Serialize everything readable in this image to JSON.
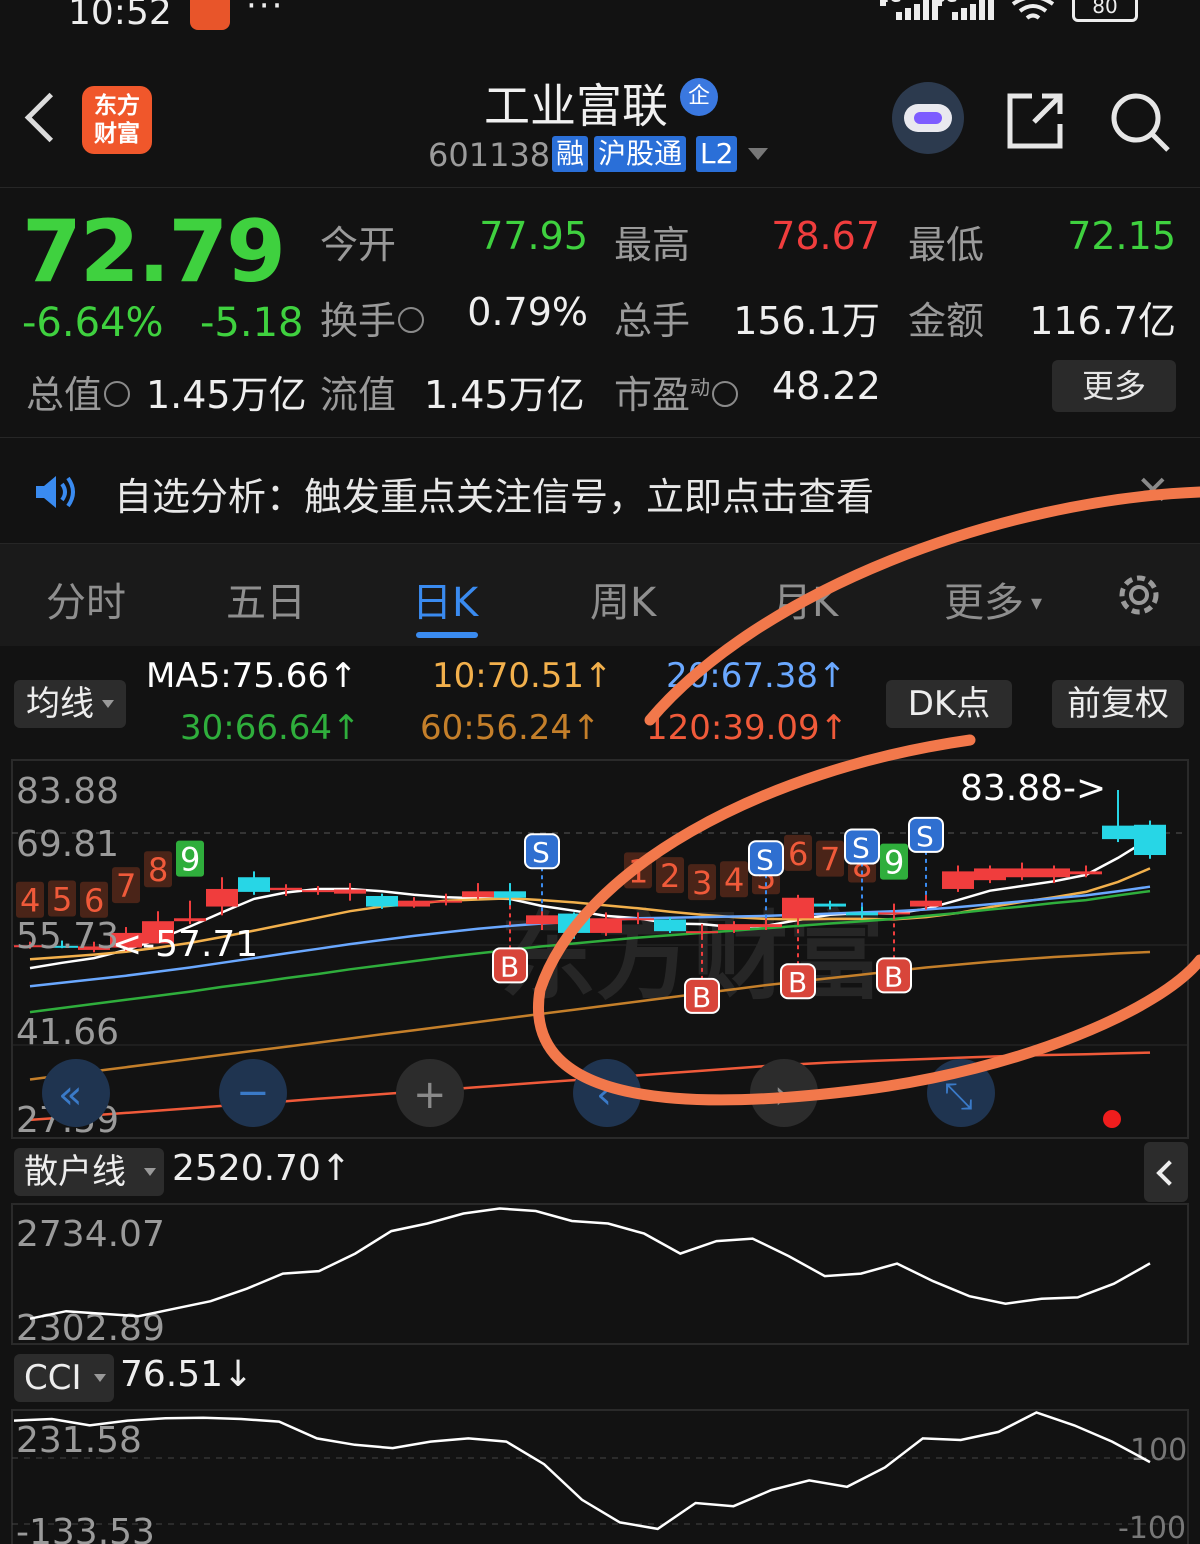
{
  "status": {
    "time": "10:52",
    "more": "···",
    "signal1": "4G",
    "signal2": "5G",
    "battery": "80"
  },
  "header": {
    "logo_line1": "东方",
    "logo_line2": "财富",
    "title": "工业富联",
    "ent_badge": "企",
    "code": "601138",
    "tags": [
      "融",
      "沪股通",
      "L2"
    ]
  },
  "quote": {
    "price": "72.79",
    "pct": "-6.64%",
    "chg": "-5.18",
    "rows": [
      [
        {
          "l": "今开",
          "v": "77.95",
          "c": "green"
        },
        {
          "l": "最高",
          "v": "78.67",
          "c": "red"
        },
        {
          "l": "最低",
          "v": "72.15",
          "c": "green"
        }
      ],
      [
        {
          "l": "换手",
          "v": "0.79%",
          "c": ""
        },
        {
          "l": "总手",
          "v": "156.1万",
          "c": ""
        },
        {
          "l": "金额",
          "v": "116.7亿",
          "c": ""
        }
      ]
    ],
    "total_value_label": "总值",
    "total_value": "1.45万亿",
    "float_label": "流值",
    "float_value": "1.45万亿",
    "pe_label": "市盈",
    "pe_sup": "动",
    "pe_value": "48.22",
    "more": "更多"
  },
  "notice": {
    "text": "自选分析：触发重点关注信号，立即点击查看",
    "close": "✕"
  },
  "tabs": {
    "items": [
      "分时",
      "五日",
      "日K",
      "周K",
      "月K",
      "更多"
    ],
    "active": "日K"
  },
  "chart_header": {
    "ma_button": "均线",
    "ma5": "MA5:75.66↑",
    "ma10": "10:70.51↑",
    "ma20": "20:67.38↑",
    "ma30": "30:66.64↑",
    "ma60": "60:56.24↑",
    "ma120": "120:39.09↑",
    "dk_button": "DK点",
    "adjust_button": "前复权"
  },
  "colors": {
    "up": "#f03d3d",
    "down": "#27d6e6",
    "ma5": "#ffffff",
    "ma10": "#f2b04c",
    "ma20": "#6aa8ff",
    "ma30": "#2fae3c",
    "ma60": "#c47f2a",
    "ma120": "#f05a3a",
    "annotation": "#f2784b"
  },
  "chart_data": [
    {
      "type": "candlestick",
      "y_ticks": [
        "83.88",
        "69.81",
        "55.73",
        "41.66",
        "27.59"
      ],
      "ylim": [
        27.59,
        83.88
      ],
      "high_label": "83.88->",
      "low_label": "<-57.71",
      "watermark": "东方财富",
      "candles": [
        {
          "o": 57.2,
          "c": 57.4,
          "h": 58.0,
          "l": 56.8
        },
        {
          "o": 57.3,
          "c": 57.1,
          "h": 58.2,
          "l": 56.9
        },
        {
          "o": 56.6,
          "c": 57.2,
          "h": 58.0,
          "l": 56.2
        },
        {
          "o": 57.0,
          "c": 59.5,
          "h": 60.5,
          "l": 56.4
        },
        {
          "o": 57.7,
          "c": 61.5,
          "h": 63.2,
          "l": 57.7
        },
        {
          "o": 61.5,
          "c": 62.0,
          "h": 65.0,
          "l": 61.0
        },
        {
          "o": 64.0,
          "c": 67.0,
          "h": 69.0,
          "l": 62.5
        },
        {
          "o": 69.0,
          "c": 66.5,
          "h": 70.0,
          "l": 66.0
        },
        {
          "o": 66.8,
          "c": 67.2,
          "h": 67.8,
          "l": 65.8
        },
        {
          "o": 66.5,
          "c": 66.8,
          "h": 67.5,
          "l": 66.0
        },
        {
          "o": 66.2,
          "c": 66.9,
          "h": 68.0,
          "l": 65.0
        },
        {
          "o": 65.8,
          "c": 64.0,
          "h": 66.2,
          "l": 63.6
        },
        {
          "o": 64.0,
          "c": 65.0,
          "h": 65.6,
          "l": 63.8
        },
        {
          "o": 65.0,
          "c": 65.0,
          "h": 66.2,
          "l": 64.2
        },
        {
          "o": 65.6,
          "c": 66.6,
          "h": 68.0,
          "l": 65.2
        },
        {
          "o": 66.6,
          "c": 65.5,
          "h": 68.0,
          "l": 64.2
        },
        {
          "o": 61.0,
          "c": 62.5,
          "h": 63.2,
          "l": 60.0
        },
        {
          "o": 62.8,
          "c": 59.5,
          "h": 63.0,
          "l": 58.5
        },
        {
          "o": 59.5,
          "c": 62.0,
          "h": 63.0,
          "l": 59.0
        },
        {
          "o": 62.0,
          "c": 62.0,
          "h": 63.0,
          "l": 61.0
        },
        {
          "o": 61.8,
          "c": 59.8,
          "h": 62.2,
          "l": 59.5
        },
        {
          "o": 59.8,
          "c": 59.8,
          "h": 61.0,
          "l": 59.0
        },
        {
          "o": 60.0,
          "c": 61.0,
          "h": 61.5,
          "l": 59.5
        },
        {
          "o": 60.5,
          "c": 61.0,
          "h": 62.0,
          "l": 60.0
        },
        {
          "o": 62.0,
          "c": 65.5,
          "h": 66.0,
          "l": 61.5
        },
        {
          "o": 64.5,
          "c": 64.0,
          "h": 65.0,
          "l": 63.5
        },
        {
          "o": 63.0,
          "c": 62.5,
          "h": 64.0,
          "l": 62.0
        },
        {
          "o": 63.0,
          "c": 63.0,
          "h": 64.5,
          "l": 62.5
        },
        {
          "o": 64.0,
          "c": 65.0,
          "h": 66.0,
          "l": 63.5
        },
        {
          "o": 67.0,
          "c": 70.0,
          "h": 71.0,
          "l": 66.5
        },
        {
          "o": 68.5,
          "c": 70.5,
          "h": 71.0,
          "l": 68.0
        },
        {
          "o": 69.0,
          "c": 70.5,
          "h": 71.5,
          "l": 68.5
        },
        {
          "o": 69.0,
          "c": 70.5,
          "h": 71.0,
          "l": 68.0
        },
        {
          "o": 69.5,
          "c": 70.0,
          "h": 71.0,
          "l": 69.0
        },
        {
          "o": 77.8,
          "c": 75.5,
          "h": 83.88,
          "l": 75.0
        },
        {
          "o": 77.95,
          "c": 72.79,
          "h": 78.67,
          "l": 72.15
        }
      ],
      "ma_lines": [
        {
          "name": "MA5",
          "color": "#ffffff",
          "values": [
            53.5,
            54.4,
            55.2,
            56.6,
            58.4,
            60.6,
            63.0,
            65.3,
            66.4,
            67.0,
            67.0,
            66.6,
            66.0,
            65.6,
            65.4,
            65.3,
            64.1,
            63.3,
            62.4,
            62.0,
            61.1,
            61.0,
            60.5,
            60.7,
            61.7,
            62.6,
            62.9,
            62.8,
            63.6,
            65.1,
            66.7,
            67.5,
            68.3,
            69.4,
            72.3,
            75.66
          ]
        },
        {
          "name": "10",
          "color": "#f2b04c",
          "values": [
            55.0,
            55.4,
            55.8,
            56.3,
            57.0,
            57.8,
            58.8,
            59.9,
            61.0,
            62.1,
            63.2,
            64.0,
            64.5,
            65.0,
            65.2,
            65.4,
            65.1,
            64.7,
            64.2,
            63.7,
            63.1,
            62.6,
            62.2,
            61.9,
            61.8,
            61.9,
            61.9,
            61.8,
            62.2,
            62.9,
            63.9,
            64.8,
            65.6,
            66.5,
            68.2,
            70.51
          ]
        },
        {
          "name": "20",
          "color": "#6aa8ff",
          "values": [
            50.4,
            51.0,
            51.6,
            52.2,
            52.9,
            53.6,
            54.4,
            55.2,
            56.0,
            56.8,
            57.6,
            58.3,
            59.0,
            59.6,
            60.2,
            60.7,
            61.1,
            61.4,
            61.7,
            62.0,
            62.1,
            62.2,
            62.3,
            62.4,
            62.6,
            62.8,
            63.0,
            63.2,
            63.5,
            63.9,
            64.4,
            64.9,
            65.4,
            65.9,
            66.6,
            67.38
          ]
        },
        {
          "name": "30",
          "color": "#2fae3c",
          "values": [
            46.0,
            46.7,
            47.4,
            48.1,
            48.8,
            49.5,
            50.3,
            51.0,
            51.8,
            52.5,
            53.3,
            54.0,
            54.7,
            55.4,
            56.0,
            56.6,
            57.2,
            57.7,
            58.2,
            58.7,
            59.1,
            59.5,
            59.9,
            60.3,
            60.7,
            61.1,
            61.5,
            61.9,
            62.4,
            62.9,
            63.5,
            64.0,
            64.6,
            65.1,
            65.9,
            66.64
          ]
        },
        {
          "name": "60",
          "color": "#c47f2a",
          "values": [
            34.5,
            35.2,
            35.9,
            36.6,
            37.3,
            38.0,
            38.7,
            39.4,
            40.1,
            40.8,
            41.5,
            42.2,
            42.9,
            43.6,
            44.3,
            45.0,
            45.7,
            46.4,
            47.1,
            47.8,
            48.5,
            49.2,
            49.9,
            50.6,
            51.2,
            51.8,
            52.4,
            53.0,
            53.6,
            54.1,
            54.6,
            55.0,
            55.4,
            55.7,
            56.0,
            56.24
          ]
        },
        {
          "name": "120",
          "color": "#f05a3a",
          "values": [
            27.6,
            28.0,
            28.4,
            28.8,
            29.2,
            29.6,
            30.0,
            30.4,
            30.8,
            31.2,
            31.6,
            32.0,
            32.4,
            32.8,
            33.2,
            33.6,
            34.0,
            34.4,
            34.8,
            35.2,
            35.6,
            36.0,
            36.4,
            36.8,
            37.1,
            37.4,
            37.6,
            37.8,
            38.0,
            38.2,
            38.4,
            38.6,
            38.7,
            38.8,
            38.95,
            39.09
          ]
        }
      ],
      "td_labels": [
        {
          "i": 0,
          "t": "4",
          "c": "#f05a3a"
        },
        {
          "i": 1,
          "t": "5",
          "c": "#f05a3a"
        },
        {
          "i": 2,
          "t": "6",
          "c": "#f05a3a"
        },
        {
          "i": 3,
          "t": "7",
          "c": "#f05a3a"
        },
        {
          "i": 4,
          "t": "8",
          "c": "#f05a3a"
        },
        {
          "i": 5,
          "t": "9",
          "c": "#2fae3c"
        },
        {
          "i": 19,
          "t": "1",
          "c": "#f05a3a"
        },
        {
          "i": 20,
          "t": "2",
          "c": "#f05a3a"
        },
        {
          "i": 21,
          "t": "3",
          "c": "#f05a3a"
        },
        {
          "i": 22,
          "t": "4",
          "c": "#f05a3a"
        },
        {
          "i": 23,
          "t": "5",
          "c": "#f05a3a"
        },
        {
          "i": 24,
          "t": "6",
          "c": "#f05a3a"
        },
        {
          "i": 25,
          "t": "7",
          "c": "#f05a3a"
        },
        {
          "i": 26,
          "t": "8",
          "c": "#f05a3a"
        },
        {
          "i": 27,
          "t": "9",
          "c": "#2fae3c"
        }
      ],
      "signals": [
        {
          "i": 16,
          "t": "S"
        },
        {
          "i": 15,
          "t": "B"
        },
        {
          "i": 21,
          "t": "B"
        },
        {
          "i": 23,
          "t": "S"
        },
        {
          "i": 24,
          "t": "B"
        },
        {
          "i": 26,
          "t": "S"
        },
        {
          "i": 27,
          "t": "B"
        },
        {
          "i": 28,
          "t": "S"
        }
      ]
    },
    {
      "type": "line",
      "name": "散户线",
      "value_label": "2520.70↑",
      "y_ticks": [
        "2734.07",
        "2302.89"
      ],
      "ylim": [
        2302.89,
        2734.07
      ],
      "values": [
        2300,
        2330,
        2320,
        2310,
        2340,
        2370,
        2420,
        2480,
        2490,
        2560,
        2650,
        2680,
        2720,
        2740,
        2730,
        2690,
        2680,
        2640,
        2560,
        2610,
        2620,
        2550,
        2470,
        2480,
        2520,
        2450,
        2390,
        2360,
        2380,
        2385,
        2440,
        2520.7
      ]
    },
    {
      "type": "line",
      "name": "CCI",
      "value_label": "76.51↓",
      "y_ticks": [
        "231.58",
        "-133.53"
      ],
      "right_ticks": [
        "100",
        "-100"
      ],
      "ylim": [
        -133.53,
        231.58
      ],
      "values": [
        205,
        210,
        190,
        205,
        212,
        214,
        210,
        202,
        150,
        130,
        120,
        140,
        150,
        140,
        70,
        -40,
        -110,
        -130,
        -50,
        -60,
        -10,
        20,
        0,
        60,
        150,
        145,
        170,
        230,
        190,
        140,
        76.51
      ]
    }
  ],
  "nav_buttons": [
    "«",
    "−",
    "+",
    "‹",
    "›",
    "⤡"
  ]
}
